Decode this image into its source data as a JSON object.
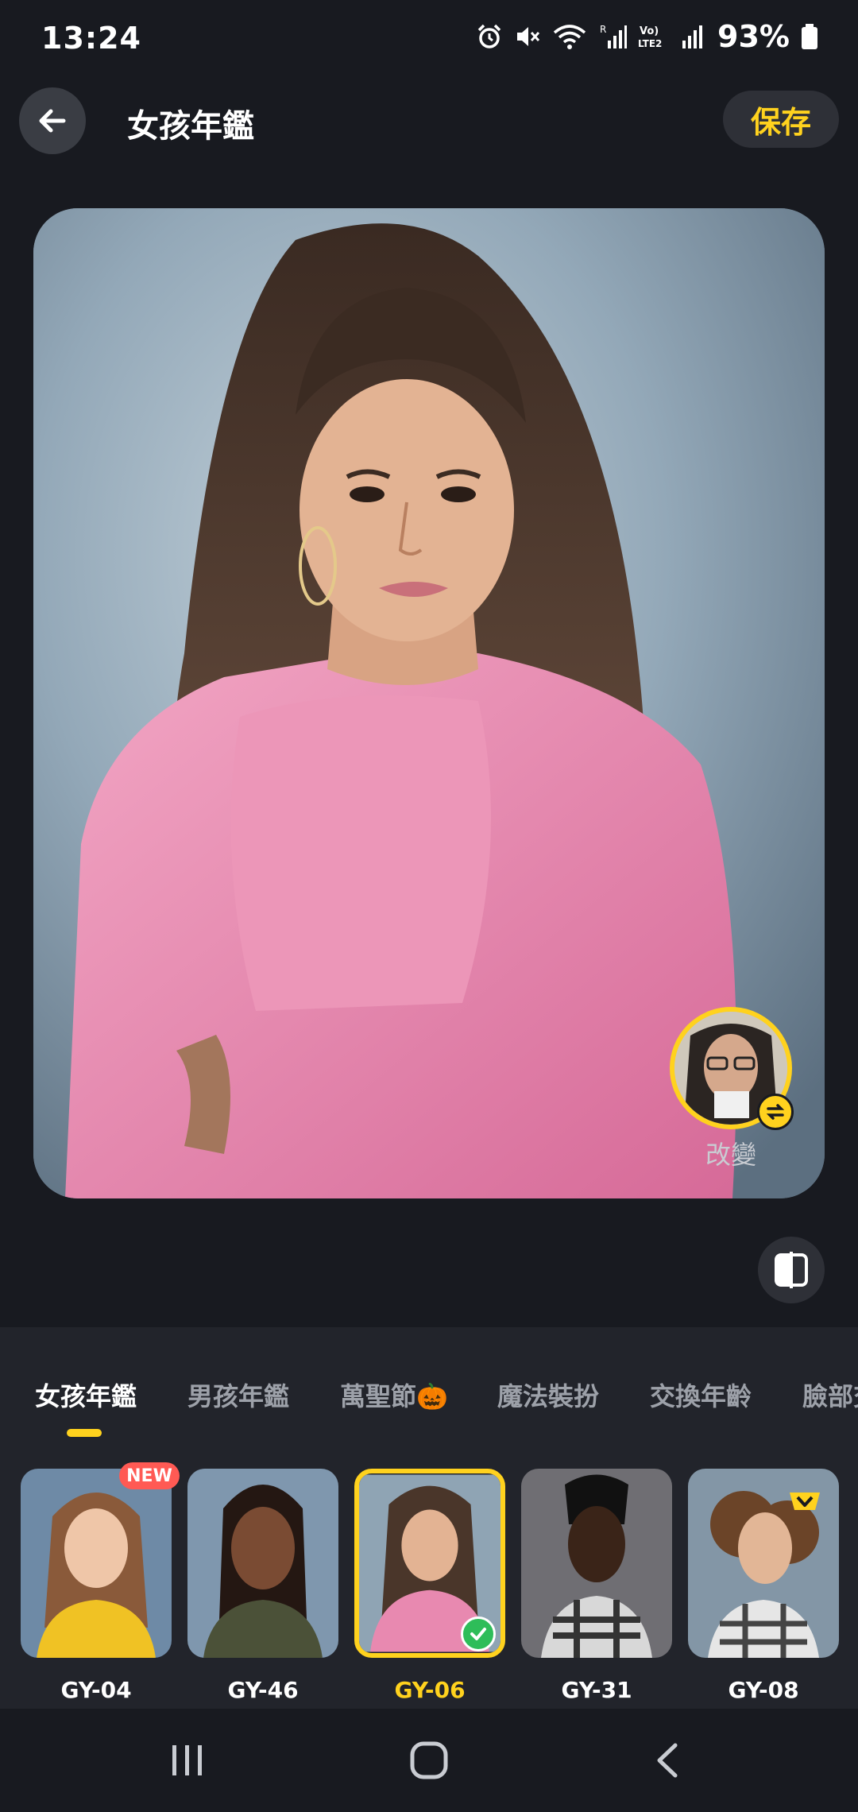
{
  "status_bar": {
    "time": "13:24",
    "battery": "93%",
    "icons": [
      "alarm-icon",
      "mute-icon",
      "wifi-icon",
      "signal-icon",
      "volte-icon",
      "signal-icon",
      "battery-icon"
    ],
    "volte_text": "Vo)\nLTE2"
  },
  "header": {
    "title": "女孩年鑑",
    "save_label": "保存",
    "back_icon": "arrow-left-icon"
  },
  "preview": {
    "change_label": "改變",
    "compare_icon": "compare-split-icon",
    "swap_icon": "swap-icon"
  },
  "tabs": [
    {
      "label": "女孩年鑑",
      "active": true
    },
    {
      "label": "男孩年鑑",
      "active": false
    },
    {
      "label": "萬聖節🎃",
      "active": false
    },
    {
      "label": "魔法裝扮",
      "active": false
    },
    {
      "label": "交換年齡",
      "active": false
    },
    {
      "label": "臉部交",
      "active": false
    }
  ],
  "templates": [
    {
      "label": "GY-04",
      "badge": "NEW",
      "selected": false
    },
    {
      "label": "GY-46",
      "badge": "",
      "selected": false
    },
    {
      "label": "GY-06",
      "badge": "",
      "selected": true
    },
    {
      "label": "GY-31",
      "badge": "",
      "selected": false
    },
    {
      "label": "GY-08",
      "badge": "premium",
      "selected": false
    }
  ],
  "colors": {
    "accent": "#ffd21e",
    "background": "#181a20",
    "panel": "#22242b",
    "new_badge": "#ff5a54",
    "check": "#2ebd59"
  },
  "nav": [
    "recent-apps-icon",
    "home-icon",
    "back-icon"
  ]
}
